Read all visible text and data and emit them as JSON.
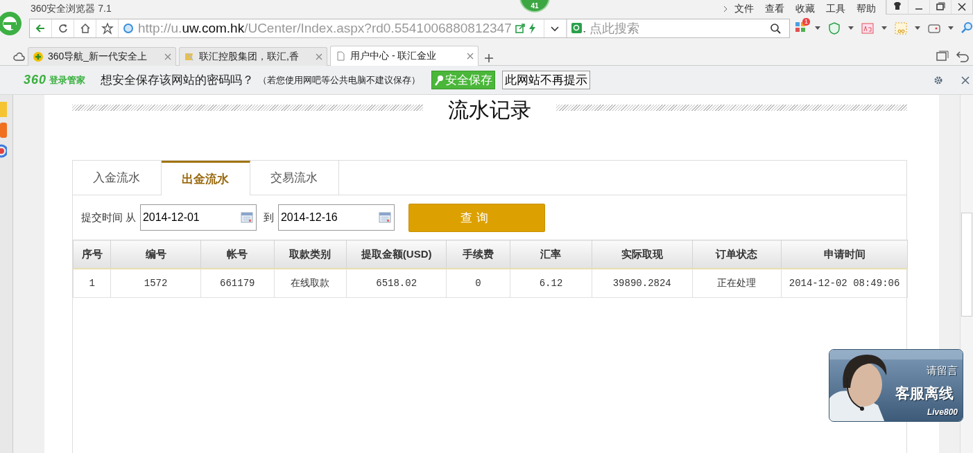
{
  "browser": {
    "title": "360安全浏览器 7.1",
    "badge": "41",
    "menu": [
      "文件",
      "查看",
      "收藏",
      "工具",
      "帮助"
    ],
    "url": {
      "prefix": "http://u.",
      "domain": "uw.com.hk",
      "path": "/UCenter/Index.aspx?rd0.5541006880812347"
    },
    "search": {
      "placeholder": "点此搜索"
    },
    "extension_badge": "1",
    "tabs": [
      {
        "label": "360导航_新一代安全上",
        "selected": false
      },
      {
        "label": "联汇控股集团，联汇,香",
        "selected": false
      },
      {
        "label": "用户中心 - 联汇金业",
        "selected": true
      }
    ]
  },
  "password_bar": {
    "brand": "360",
    "brand_sub": "登录管家",
    "question": "想安全保存该网站的密码吗？",
    "note": "（若您使用网吧等公共电脑不建议保存）",
    "save_button": "安全保存",
    "never_button": "此网站不再提示"
  },
  "page": {
    "heading": "流水记录",
    "tabs": [
      {
        "label": "入金流水",
        "selected": false
      },
      {
        "label": "出金流水",
        "selected": true
      },
      {
        "label": "交易流水",
        "selected": false
      }
    ],
    "filter": {
      "label": "提交时间",
      "from_label": "从",
      "from": "2014-12-01",
      "to_label": "到",
      "to": "2014-12-16",
      "button": "查询"
    },
    "table": {
      "columns": [
        "序号",
        "编号",
        "帐号",
        "取款类别",
        "提取金额(USD)",
        "手续费",
        "汇率",
        "实际取现",
        "订单状态",
        "申请时间"
      ],
      "rows": [
        [
          "1",
          "1572",
          "661179",
          "在线取款",
          "6518.02",
          "0",
          "6.12",
          "39890.2824",
          "正在处理",
          "2014-12-02 08:49:06"
        ]
      ]
    }
  },
  "chat": {
    "prompt": "请留言",
    "status": "客服离线",
    "brand": "Live800"
  }
}
